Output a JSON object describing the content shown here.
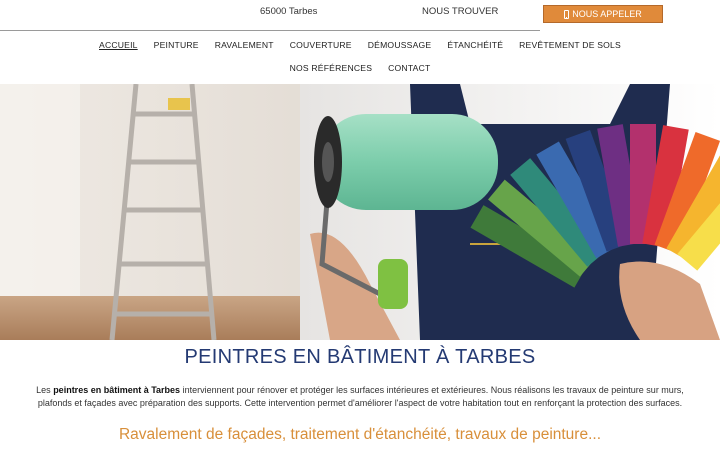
{
  "topbar": {
    "location": "65000 Tarbes",
    "find_us": "NOUS TROUVER",
    "call_label": "NOUS APPELER"
  },
  "nav": {
    "row1": [
      "ACCUEIL",
      "PEINTURE",
      "RAVALEMENT",
      "COUVERTURE",
      "DÉMOUSSAGE",
      "ÉTANCHÉITÉ",
      "REVÊTEMENT DE SOLS"
    ],
    "row2": [
      "NOS RÉFÉRENCES",
      "CONTACT"
    ]
  },
  "content": {
    "title": "PEINTRES EN BÂTIMENT À TARBES",
    "intro_prefix": "Les ",
    "intro_bold": "peintres en bâtiment à Tarbes",
    "intro_rest": " interviennent pour rénover et protéger les surfaces intérieures et extérieures. Nous réalisons les travaux de peinture sur murs, plafonds et façades avec préparation des supports. Cette intervention permet d'améliorer l'aspect de votre habitation tout en renforçant la protection des surfaces.",
    "subtitle": "Ravalement de façades, traitement d'étanchéité, travaux de peinture..."
  },
  "colors": {
    "accent_orange": "#e08a3a",
    "title_blue": "#243a73",
    "subtitle_orange": "#d88f3a"
  },
  "icons": {
    "call": "phone-icon"
  }
}
